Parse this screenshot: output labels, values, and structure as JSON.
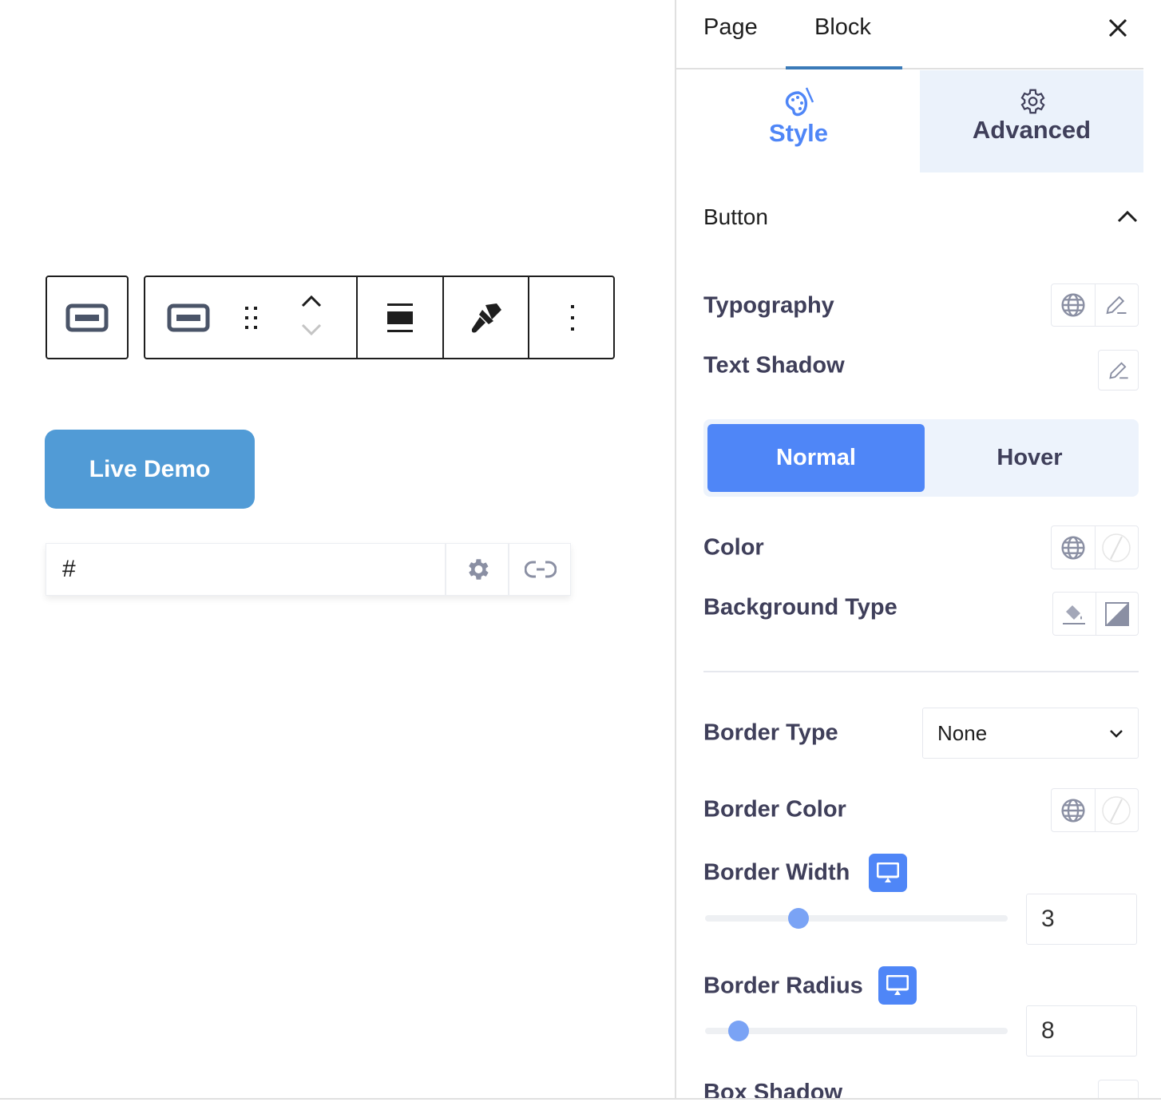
{
  "sidebar_header": {
    "tabs": [
      {
        "label": "Page"
      },
      {
        "label": "Block",
        "active": true
      }
    ],
    "close_icon": "close-icon"
  },
  "panel_tabs": [
    {
      "label": "Style",
      "icon": "palette-icon",
      "active": true
    },
    {
      "label": "Advanced",
      "icon": "gear-icon"
    }
  ],
  "section": {
    "title": "Button",
    "expanded": true
  },
  "fields": {
    "typography": "Typography",
    "text_shadow": "Text Shadow",
    "state_toggle": {
      "options": [
        "Normal",
        "Hover"
      ],
      "selected": "Normal"
    },
    "color": "Color",
    "background_type": "Background Type",
    "border_type": {
      "label": "Border Type",
      "value": "None"
    },
    "border_color": "Border Color",
    "border_width": {
      "label": "Border Width",
      "value": "3",
      "slider_fraction": 0.31
    },
    "border_radius": {
      "label": "Border Radius",
      "value": "8",
      "slider_fraction": 0.11
    },
    "box_shadow": "Box Shadow"
  },
  "canvas": {
    "button_label": "Live Demo",
    "url_value": "#"
  },
  "colors": {
    "accent": "#4f86f7",
    "button_bg": "#519bd6",
    "tab_underline": "#3a7ab8",
    "label": "#3f3f5a"
  }
}
